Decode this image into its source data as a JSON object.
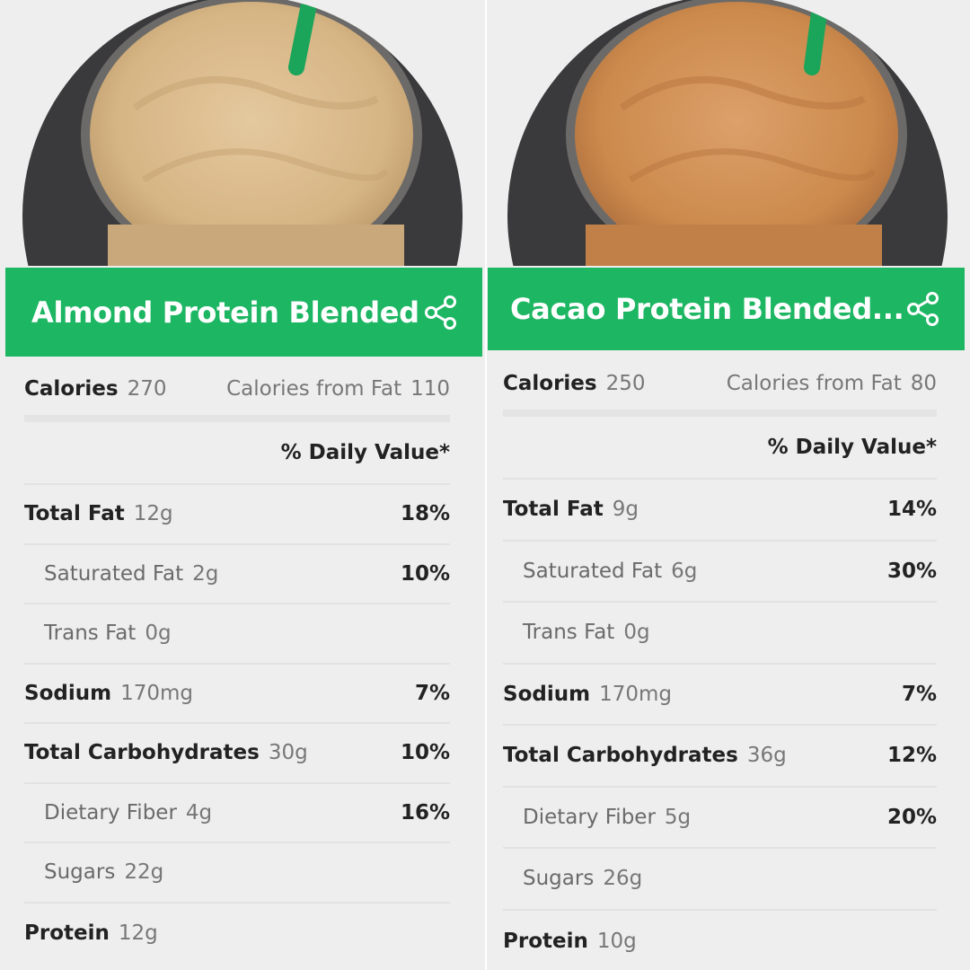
{
  "panels": [
    {
      "title": "Almond Protein Blended...",
      "calories_label": "Calories",
      "calories_value": "270",
      "cal_from_fat_label": "Calories from Fat",
      "cal_from_fat_value": "110",
      "daily_value_header": "% Daily Value*",
      "rows": [
        {
          "label": "Total Fat",
          "amount": "12g",
          "pct": "18%",
          "sub": false
        },
        {
          "label": "Saturated Fat",
          "amount": "2g",
          "pct": "10%",
          "sub": true
        },
        {
          "label": "Trans Fat",
          "amount": "0g",
          "pct": "",
          "sub": true
        },
        {
          "label": "Sodium",
          "amount": "170mg",
          "pct": "7%",
          "sub": false
        },
        {
          "label": "Total Carbohydrates",
          "amount": "30g",
          "pct": "10%",
          "sub": false
        },
        {
          "label": "Dietary Fiber",
          "amount": "4g",
          "pct": "16%",
          "sub": true
        },
        {
          "label": "Sugars",
          "amount": "22g",
          "pct": "",
          "sub": true
        },
        {
          "label": "Protein",
          "amount": "12g",
          "pct": "",
          "sub": false
        }
      ]
    },
    {
      "title": "Cacao Protein Blended...",
      "calories_label": "Calories",
      "calories_value": "250",
      "cal_from_fat_label": "Calories from Fat",
      "cal_from_fat_value": "80",
      "daily_value_header": "% Daily Value*",
      "rows": [
        {
          "label": "Total Fat",
          "amount": "9g",
          "pct": "14%",
          "sub": false
        },
        {
          "label": "Saturated Fat",
          "amount": "6g",
          "pct": "30%",
          "sub": true
        },
        {
          "label": "Trans Fat",
          "amount": "0g",
          "pct": "",
          "sub": true
        },
        {
          "label": "Sodium",
          "amount": "170mg",
          "pct": "7%",
          "sub": false
        },
        {
          "label": "Total Carbohydrates",
          "amount": "36g",
          "pct": "12%",
          "sub": false
        },
        {
          "label": "Dietary Fiber",
          "amount": "5g",
          "pct": "20%",
          "sub": true
        },
        {
          "label": "Sugars",
          "amount": "26g",
          "pct": "",
          "sub": true
        },
        {
          "label": "Protein",
          "amount": "10g",
          "pct": "",
          "sub": false
        }
      ]
    }
  ],
  "icons": {
    "share": "share-icon"
  },
  "colors": {
    "header_green": "#1db663",
    "background": "#eeeeee",
    "almond_drink": "#d9b98c",
    "cacao_drink": "#cc8a4c",
    "straw": "#1aa55a"
  }
}
